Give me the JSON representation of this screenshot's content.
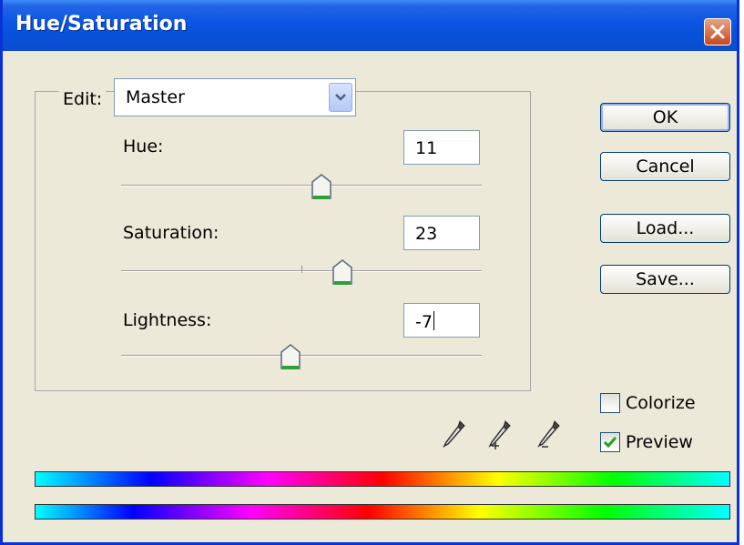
{
  "window": {
    "title": "Hue/Saturation"
  },
  "edit": {
    "label": "Edit:",
    "selected": "Master"
  },
  "sliders": {
    "hue": {
      "label": "Hue:",
      "value": "11"
    },
    "saturation": {
      "label": "Saturation:",
      "value": "23"
    },
    "lightness": {
      "label": "Lightness:",
      "value": "-7"
    }
  },
  "buttons": {
    "ok": "OK",
    "cancel": "Cancel",
    "load": "Load...",
    "save": "Save..."
  },
  "options": {
    "colorize": {
      "label": "Colorize",
      "checked": false
    },
    "preview": {
      "label": "Preview",
      "checked": true
    }
  },
  "icons": [
    "close-icon",
    "chevron-down-icon",
    "eyedropper-icon",
    "eyedropper-plus-icon",
    "eyedropper-minus-icon",
    "checkmark-icon"
  ],
  "colors": {
    "title_bar": "#0a55e3",
    "dialog_bg": "#ece9d8",
    "close_button": "#c84721",
    "thumb_accent": "#2e9e3e"
  }
}
